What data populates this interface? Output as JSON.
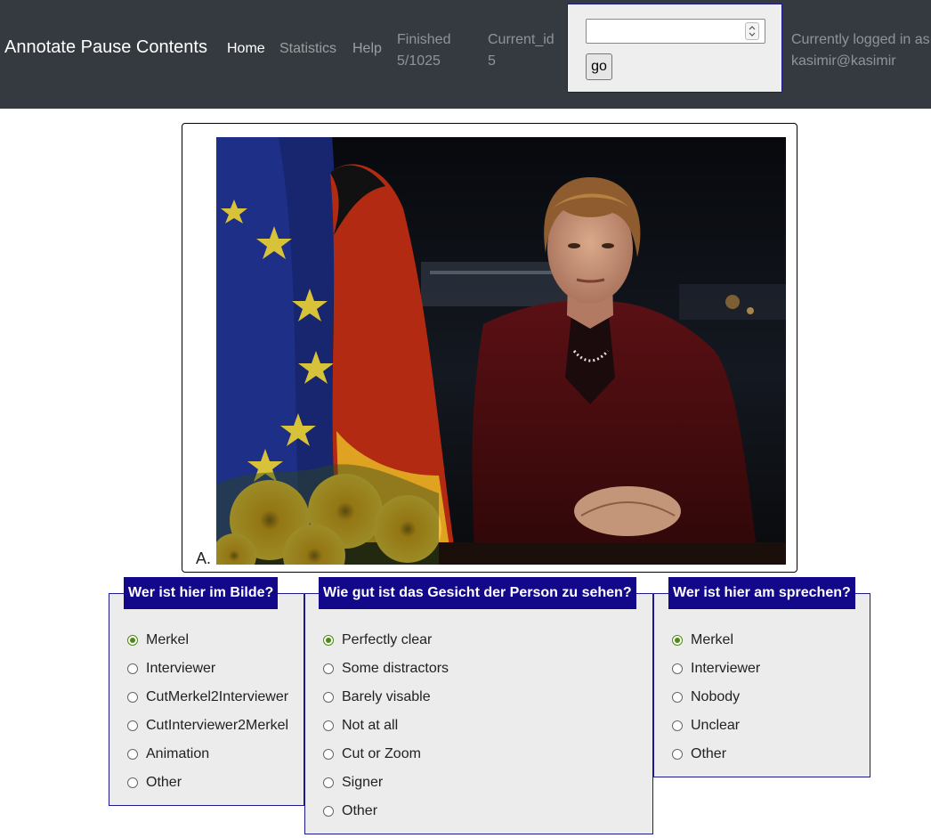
{
  "navbar": {
    "brand": "Annotate Pause Contents",
    "links": [
      {
        "label": "Home",
        "active": true
      },
      {
        "label": "Statistics",
        "active": false
      },
      {
        "label": "Help",
        "active": false
      }
    ],
    "finished_label": "Finished",
    "finished_value": "5/1025",
    "current_id_label": "Current_id",
    "current_id_value": "5",
    "goto": {
      "input_value": "",
      "button_label": "go"
    },
    "login_line1": "Currently logged in as",
    "login_line2": "kasimir@kasimir"
  },
  "video": {
    "label": "A."
  },
  "panels": [
    {
      "title": "Wer ist hier im Bilde?",
      "options": [
        "Merkel",
        "Interviewer",
        "CutMerkel2Interviewer",
        "CutInterviewer2Merkel",
        "Animation",
        "Other"
      ],
      "selected": 0
    },
    {
      "title": "Wie gut ist das Gesicht der Person zu sehen?",
      "options": [
        "Perfectly clear",
        "Some distractors",
        "Barely visable",
        "Not at all",
        "Cut or Zoom",
        "Signer",
        "Other"
      ],
      "selected": 0
    },
    {
      "title": "Wer ist hier am sprechen?",
      "options": [
        "Merkel",
        "Interviewer",
        "Nobody",
        "Unclear",
        "Other"
      ],
      "selected": 0
    }
  ],
  "colors": {
    "navbar_bg": "#343a40",
    "panel_header_bg": "#13088a",
    "radio_checked": "#4c8a13"
  }
}
